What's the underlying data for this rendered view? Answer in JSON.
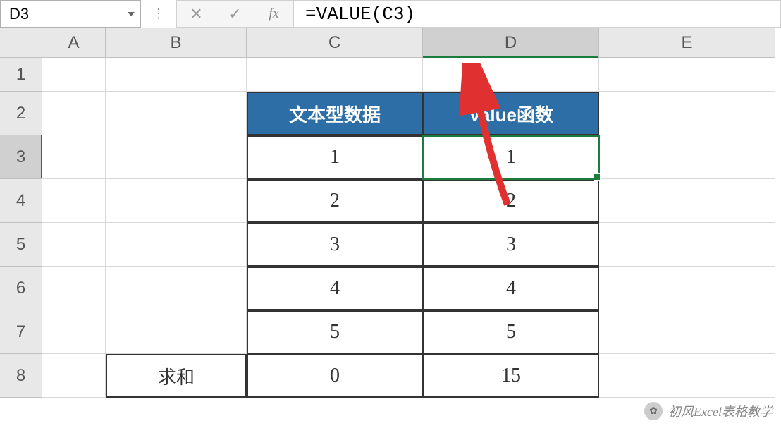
{
  "nameBox": "D3",
  "formula": "=VALUE(C3)",
  "columns": [
    "A",
    "B",
    "C",
    "D",
    "E"
  ],
  "rows": [
    "1",
    "2",
    "3",
    "4",
    "5",
    "6",
    "7",
    "8"
  ],
  "table": {
    "headers": {
      "c": "文本型数据",
      "d": "Value函数"
    },
    "data": [
      {
        "c": "1",
        "d": "1"
      },
      {
        "c": "2",
        "d": "2"
      },
      {
        "c": "3",
        "d": "3"
      },
      {
        "c": "4",
        "d": "4"
      },
      {
        "c": "5",
        "d": "5"
      }
    ],
    "sumLabel": "求和",
    "sumC": "0",
    "sumD": "15"
  },
  "watermark": "初风Excel表格教学",
  "icons": {
    "cancel": "✕",
    "confirm": "✓",
    "fx": "fx",
    "dots": "⋮"
  }
}
